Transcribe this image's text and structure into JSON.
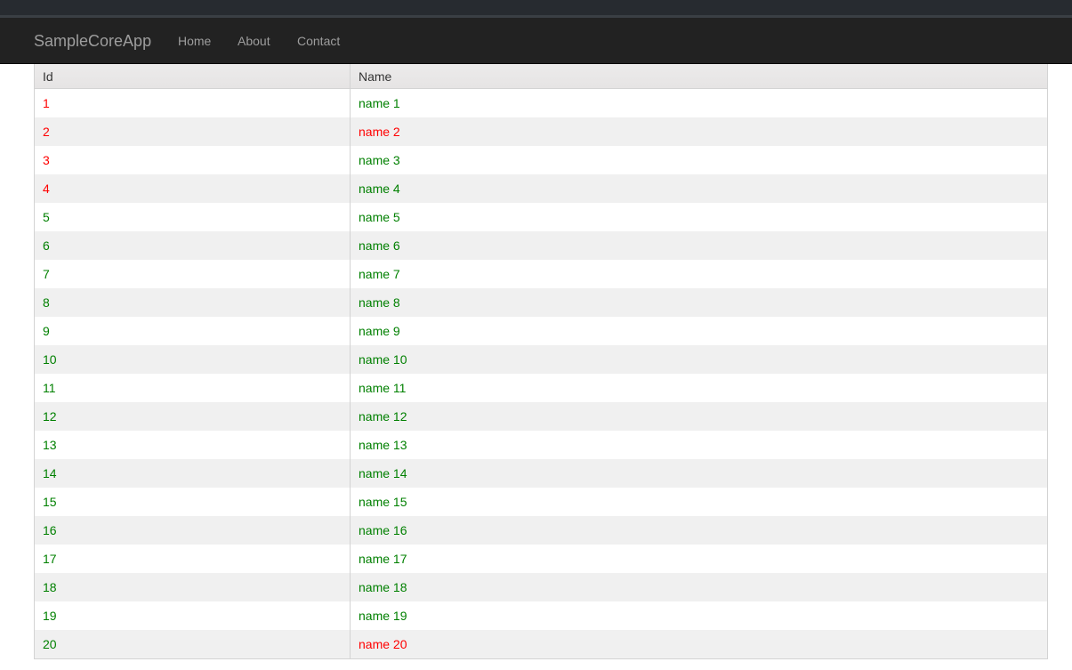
{
  "navbar": {
    "brand": "SampleCoreApp",
    "links": [
      {
        "label": "Home"
      },
      {
        "label": "About"
      },
      {
        "label": "Contact"
      }
    ]
  },
  "colors": {
    "red": "#ff0000",
    "green": "#008000"
  },
  "table": {
    "columns": [
      "Id",
      "Name"
    ],
    "rows": [
      {
        "id": "1",
        "name": "name 1",
        "id_color": "#ff0000",
        "name_color": "#008000"
      },
      {
        "id": "2",
        "name": "name 2",
        "id_color": "#ff0000",
        "name_color": "#ff0000"
      },
      {
        "id": "3",
        "name": "name 3",
        "id_color": "#ff0000",
        "name_color": "#008000"
      },
      {
        "id": "4",
        "name": "name 4",
        "id_color": "#ff0000",
        "name_color": "#008000"
      },
      {
        "id": "5",
        "name": "name 5",
        "id_color": "#008000",
        "name_color": "#008000"
      },
      {
        "id": "6",
        "name": "name 6",
        "id_color": "#008000",
        "name_color": "#008000"
      },
      {
        "id": "7",
        "name": "name 7",
        "id_color": "#008000",
        "name_color": "#008000"
      },
      {
        "id": "8",
        "name": "name 8",
        "id_color": "#008000",
        "name_color": "#008000"
      },
      {
        "id": "9",
        "name": "name 9",
        "id_color": "#008000",
        "name_color": "#008000"
      },
      {
        "id": "10",
        "name": "name 10",
        "id_color": "#008000",
        "name_color": "#008000"
      },
      {
        "id": "11",
        "name": "name 11",
        "id_color": "#008000",
        "name_color": "#008000"
      },
      {
        "id": "12",
        "name": "name 12",
        "id_color": "#008000",
        "name_color": "#008000"
      },
      {
        "id": "13",
        "name": "name 13",
        "id_color": "#008000",
        "name_color": "#008000"
      },
      {
        "id": "14",
        "name": "name 14",
        "id_color": "#008000",
        "name_color": "#008000"
      },
      {
        "id": "15",
        "name": "name 15",
        "id_color": "#008000",
        "name_color": "#008000"
      },
      {
        "id": "16",
        "name": "name 16",
        "id_color": "#008000",
        "name_color": "#008000"
      },
      {
        "id": "17",
        "name": "name 17",
        "id_color": "#008000",
        "name_color": "#008000"
      },
      {
        "id": "18",
        "name": "name 18",
        "id_color": "#008000",
        "name_color": "#008000"
      },
      {
        "id": "19",
        "name": "name 19",
        "id_color": "#008000",
        "name_color": "#008000"
      },
      {
        "id": "20",
        "name": "name 20",
        "id_color": "#008000",
        "name_color": "#ff0000"
      }
    ]
  }
}
